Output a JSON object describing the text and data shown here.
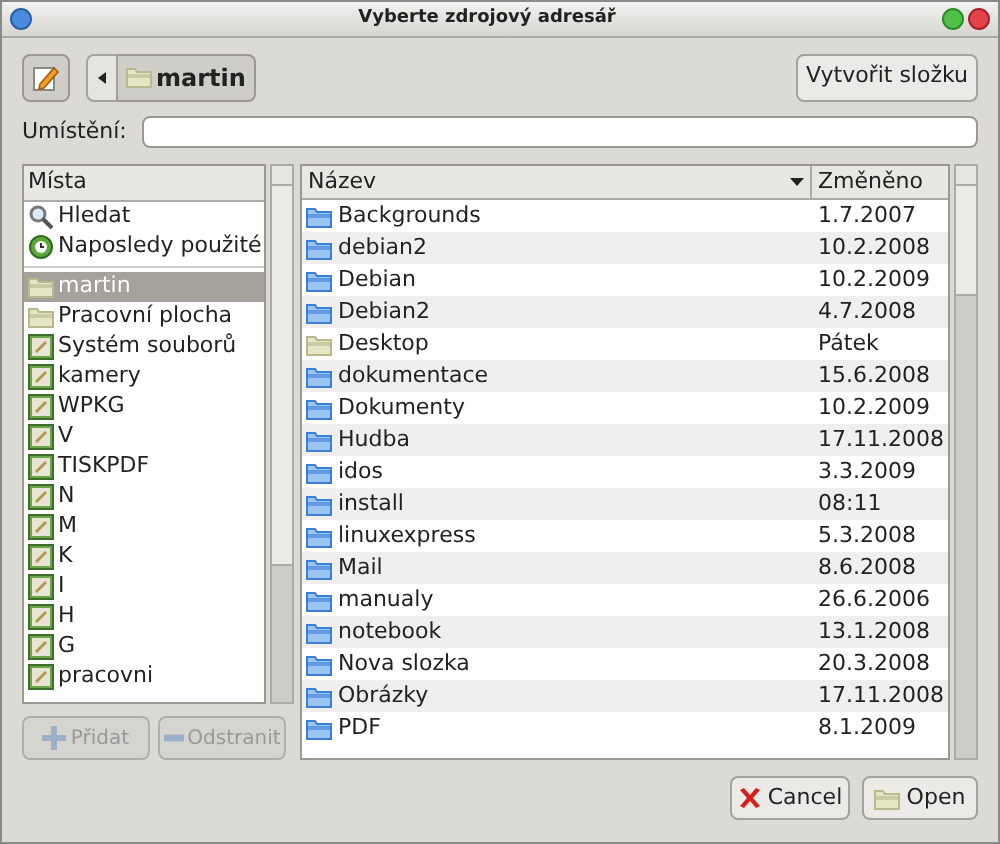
{
  "window": {
    "title": "Vyberte zdrojový adresář"
  },
  "toolbar": {
    "path_button": "martin",
    "create_folder": "Vytvořit složku"
  },
  "location": {
    "label": "Umístění:"
  },
  "places": {
    "header": "Místa",
    "items": [
      {
        "label": "Hledat",
        "kind": "search",
        "selected": false
      },
      {
        "label": "Naposledy použité",
        "kind": "recent",
        "selected": false
      },
      {
        "label": "martin",
        "kind": "home",
        "selected": true
      },
      {
        "label": "Pracovní plocha",
        "kind": "home",
        "selected": false
      },
      {
        "label": "Systém souborů",
        "kind": "drive",
        "selected": false
      },
      {
        "label": "kamery",
        "kind": "drive",
        "selected": false
      },
      {
        "label": "WPKG",
        "kind": "drive",
        "selected": false
      },
      {
        "label": "V",
        "kind": "drive",
        "selected": false
      },
      {
        "label": "TISKPDF",
        "kind": "drive",
        "selected": false
      },
      {
        "label": "N",
        "kind": "drive",
        "selected": false
      },
      {
        "label": "M",
        "kind": "drive",
        "selected": false
      },
      {
        "label": "K",
        "kind": "drive",
        "selected": false
      },
      {
        "label": "I",
        "kind": "drive",
        "selected": false
      },
      {
        "label": "H",
        "kind": "drive",
        "selected": false
      },
      {
        "label": "G",
        "kind": "drive",
        "selected": false
      },
      {
        "label": "pracovni",
        "kind": "drive",
        "selected": false
      }
    ],
    "add": {
      "label": "Přidat",
      "disabled": true
    },
    "remove": {
      "label": "Odstranit",
      "disabled": true
    }
  },
  "files": {
    "columns": [
      "Název",
      "Změněno"
    ],
    "rows": [
      {
        "name": "Backgrounds",
        "modified": "1.7.2007",
        "kind": "folder"
      },
      {
        "name": "debian2",
        "modified": "10.2.2008",
        "kind": "folder"
      },
      {
        "name": "Debian",
        "modified": "10.2.2009",
        "kind": "folder"
      },
      {
        "name": "Debian2",
        "modified": "4.7.2008",
        "kind": "folder"
      },
      {
        "name": "Desktop",
        "modified": "Pátek",
        "kind": "desktop"
      },
      {
        "name": "dokumentace",
        "modified": "15.6.2008",
        "kind": "folder"
      },
      {
        "name": "Dokumenty",
        "modified": "10.2.2009",
        "kind": "folder"
      },
      {
        "name": "Hudba",
        "modified": "17.11.2008",
        "kind": "folder"
      },
      {
        "name": "idos",
        "modified": "3.3.2009",
        "kind": "folder"
      },
      {
        "name": "install",
        "modified": "08:11",
        "kind": "folder"
      },
      {
        "name": "linuxexpress",
        "modified": "5.3.2008",
        "kind": "folder"
      },
      {
        "name": "Mail",
        "modified": "8.6.2008",
        "kind": "folder"
      },
      {
        "name": "manualy",
        "modified": "26.6.2006",
        "kind": "folder"
      },
      {
        "name": "notebook",
        "modified": "13.1.2008",
        "kind": "folder"
      },
      {
        "name": "Nova slozka",
        "modified": "20.3.2008",
        "kind": "folder"
      },
      {
        "name": "Obrázky",
        "modified": "17.11.2008",
        "kind": "folder"
      },
      {
        "name": "PDF",
        "modified": "8.1.2009",
        "kind": "folder"
      }
    ]
  },
  "buttons": {
    "cancel": "Cancel",
    "open": "Open"
  }
}
